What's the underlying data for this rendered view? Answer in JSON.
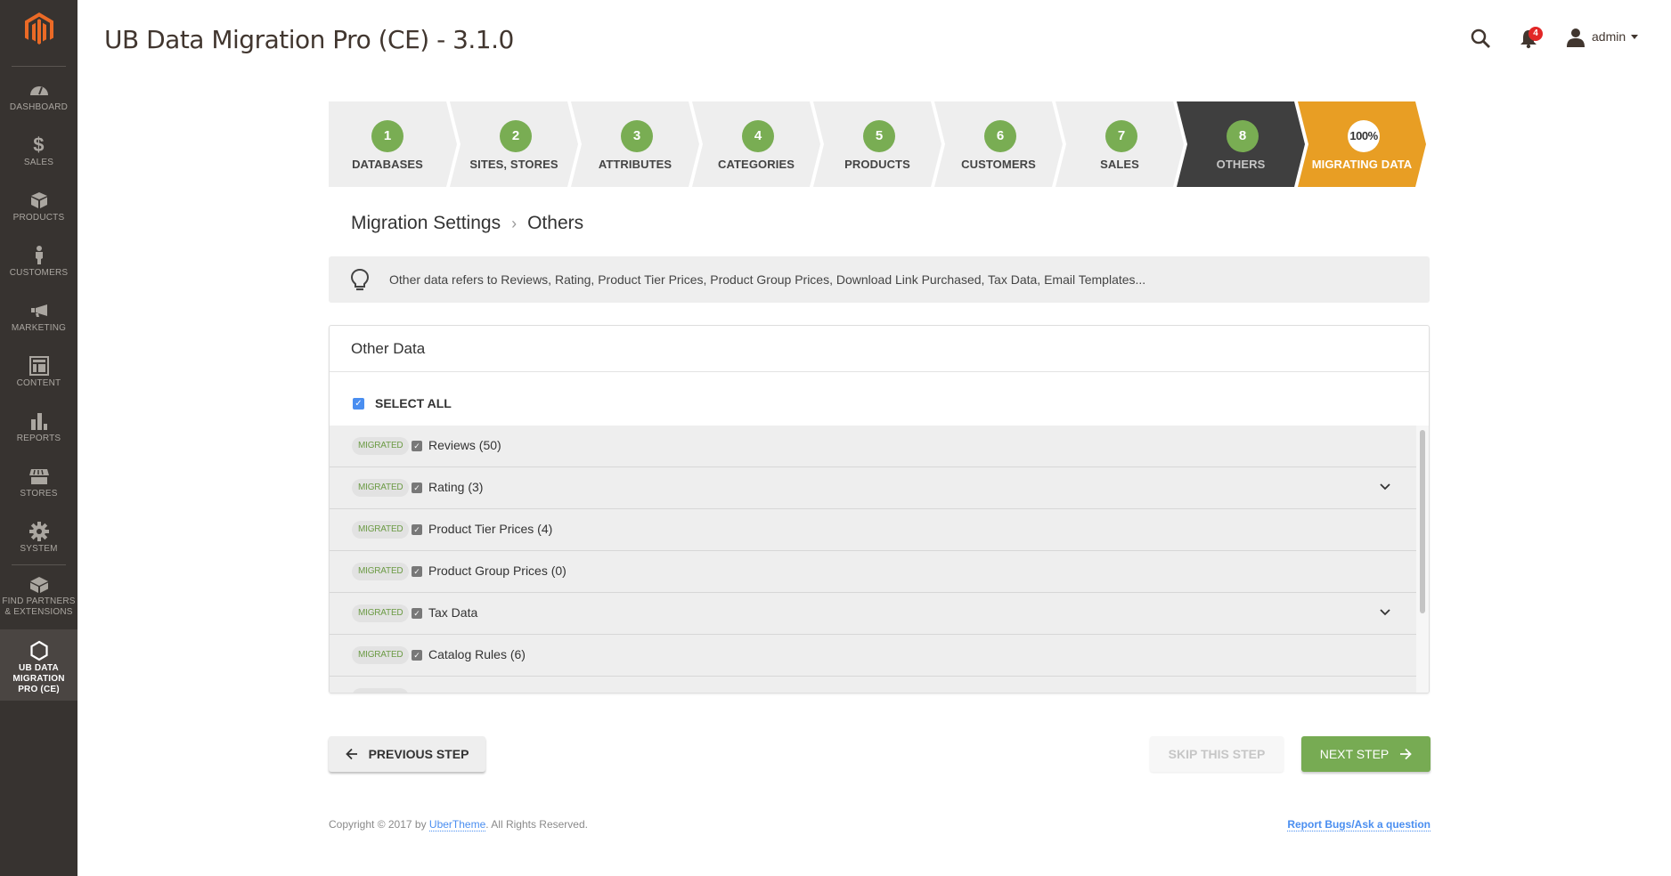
{
  "app": {
    "title": "UB Data Migration Pro (CE) - 3.1.0"
  },
  "sidebar": {
    "logo": "magento-logo",
    "items": [
      {
        "label": "DASHBOARD",
        "icon": "dashboard-icon"
      },
      {
        "label": "SALES",
        "icon": "dollar-icon"
      },
      {
        "label": "PRODUCTS",
        "icon": "box-icon"
      },
      {
        "label": "CUSTOMERS",
        "icon": "person-icon"
      },
      {
        "label": "MARKETING",
        "icon": "megaphone-icon"
      },
      {
        "label": "CONTENT",
        "icon": "layout-icon"
      },
      {
        "label": "REPORTS",
        "icon": "bar-chart-icon"
      },
      {
        "label": "STORES",
        "icon": "storefront-icon"
      },
      {
        "label": "SYSTEM",
        "icon": "gear-icon"
      },
      {
        "label": "FIND PARTNERS & EXTENSIONS",
        "line1": "FIND PARTNERS",
        "line2": "& EXTENSIONS",
        "icon": "lego-brick-icon"
      },
      {
        "label": "UB DATA MIGRATION PRO (CE)",
        "line1": "UB DATA",
        "line2": "MIGRATION",
        "line3": "PRO (CE)",
        "icon": "hexagon-icon",
        "active": true
      }
    ]
  },
  "header": {
    "notifications_count": "4",
    "user": "admin"
  },
  "stepper": {
    "steps": [
      {
        "number": "1",
        "label": "DATABASES",
        "state": "done"
      },
      {
        "number": "2",
        "label": "SITES, STORES",
        "state": "done"
      },
      {
        "number": "3",
        "label": "ATTRIBUTES",
        "state": "done"
      },
      {
        "number": "4",
        "label": "CATEGORIES",
        "state": "done"
      },
      {
        "number": "5",
        "label": "PRODUCTS",
        "state": "done"
      },
      {
        "number": "6",
        "label": "CUSTOMERS",
        "state": "done"
      },
      {
        "number": "7",
        "label": "SALES",
        "state": "done"
      },
      {
        "number": "8",
        "label": "OTHERS",
        "state": "current"
      }
    ],
    "final": {
      "progress": "100%",
      "label": "MIGRATING DATA"
    }
  },
  "breadcrumb": {
    "parent": "Migration Settings",
    "separator": "›",
    "current": "Others"
  },
  "info": {
    "text": "Other data refers to Reviews, Rating, Product Tier Prices, Product Group Prices, Download Link Purchased, Tax Data, Email Templates..."
  },
  "card": {
    "title": "Other Data",
    "select_all": {
      "label": "SELECT ALL",
      "checked": true
    },
    "rows": [
      {
        "status": "MIGRATED",
        "label": "Reviews (50)",
        "checked": true,
        "expandable": false
      },
      {
        "status": "MIGRATED",
        "label": "Rating (3)",
        "checked": true,
        "expandable": true
      },
      {
        "status": "MIGRATED",
        "label": "Product Tier Prices (4)",
        "checked": true,
        "expandable": false
      },
      {
        "status": "MIGRATED",
        "label": "Product Group Prices (0)",
        "checked": true,
        "expandable": false
      },
      {
        "status": "MIGRATED",
        "label": "Tax Data",
        "checked": true,
        "expandable": true
      },
      {
        "status": "MIGRATED",
        "label": "Catalog Rules (6)",
        "checked": true,
        "expandable": false
      }
    ]
  },
  "buttons": {
    "previous": "PREVIOUS STEP",
    "skip": "SKIP THIS STEP",
    "next": "NEXT STEP"
  },
  "footer": {
    "copyright_prefix": "Copyright © 2017 by ",
    "company": "UberTheme",
    "copyright_suffix": ". All Rights Reserved.",
    "report_link": "Report Bugs/Ask a question"
  },
  "colors": {
    "sidebar_bg": "#373330",
    "step_done": "#79ad53",
    "step_current_bg": "#3f3f3f",
    "step_final_bg": "#e89e24",
    "migrated_text": "#6c9b45",
    "next_button": "#77ab53",
    "link": "#4a8ef0",
    "notification_badge": "#e22626"
  }
}
